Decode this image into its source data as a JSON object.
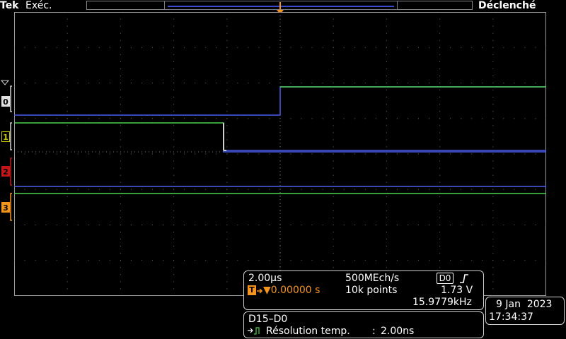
{
  "header": {
    "brand": "Tek",
    "run_state": "Exéc.",
    "trigger_state": "Déclenché"
  },
  "trigger_marker": {
    "label": "T"
  },
  "channels": [
    "0",
    "1",
    "2",
    "3"
  ],
  "acquisition": {
    "timebase": "2.00µs",
    "sample_rate": "500MEch/s",
    "source_badge": "D0",
    "slope_icon": "rising-edge",
    "trigger_icon": "T",
    "trigger_position": "▼0.00000 s",
    "record_length": "10k points",
    "trigger_level": "1.73 V",
    "frequency": "15.9779kHz"
  },
  "bus": {
    "name": "D15–D0",
    "resolution_label": "Résolution temp.",
    "resolution_sep": ":",
    "resolution_value": "2.00ns"
  },
  "datetime": {
    "date": "9 Jan  2023",
    "time": "17:34:37"
  },
  "colors": {
    "green_trace": "#4cd44c",
    "blue_trace": "#4a5cf0",
    "orange": "#f7941d",
    "ch0": "#d8d8d8",
    "ch1": "#c8c800",
    "ch2": "#c01818",
    "ch3": "#f7941d"
  }
}
